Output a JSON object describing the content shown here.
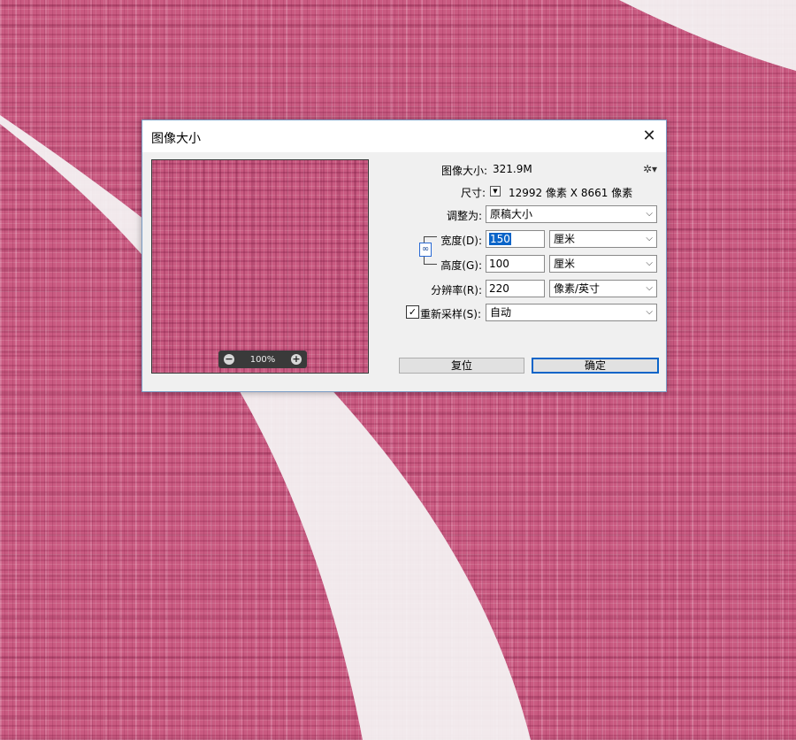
{
  "dialog": {
    "title": "图像大小",
    "close_label": "✕",
    "image_size_label": "图像大小:",
    "image_size_value": "321.9M",
    "dimensions_label": "尺寸:",
    "dimensions_value": "12992 像素  X  8661 像素",
    "fit_to_label": "调整为:",
    "fit_to_value": "原稿大小",
    "width_label": "宽度(D):",
    "width_value": "150",
    "width_unit": "厘米",
    "height_label": "高度(G):",
    "height_value": "100",
    "height_unit": "厘米",
    "resolution_label": "分辨率(R):",
    "resolution_value": "220",
    "resolution_unit": "像素/英寸",
    "resample_label": "重新采样(S):",
    "resample_checked": true,
    "resample_value": "自动",
    "reset_button": "复位",
    "ok_button": "确定"
  },
  "preview": {
    "zoom_value": "100%",
    "zoom_out_label": "−",
    "zoom_in_label": "+"
  },
  "icons": {
    "gear": "gear-icon",
    "chain": "link-icon",
    "close": "close-icon"
  },
  "colors": {
    "accent": "#0a64c8",
    "background_pink": "#c95a81"
  }
}
